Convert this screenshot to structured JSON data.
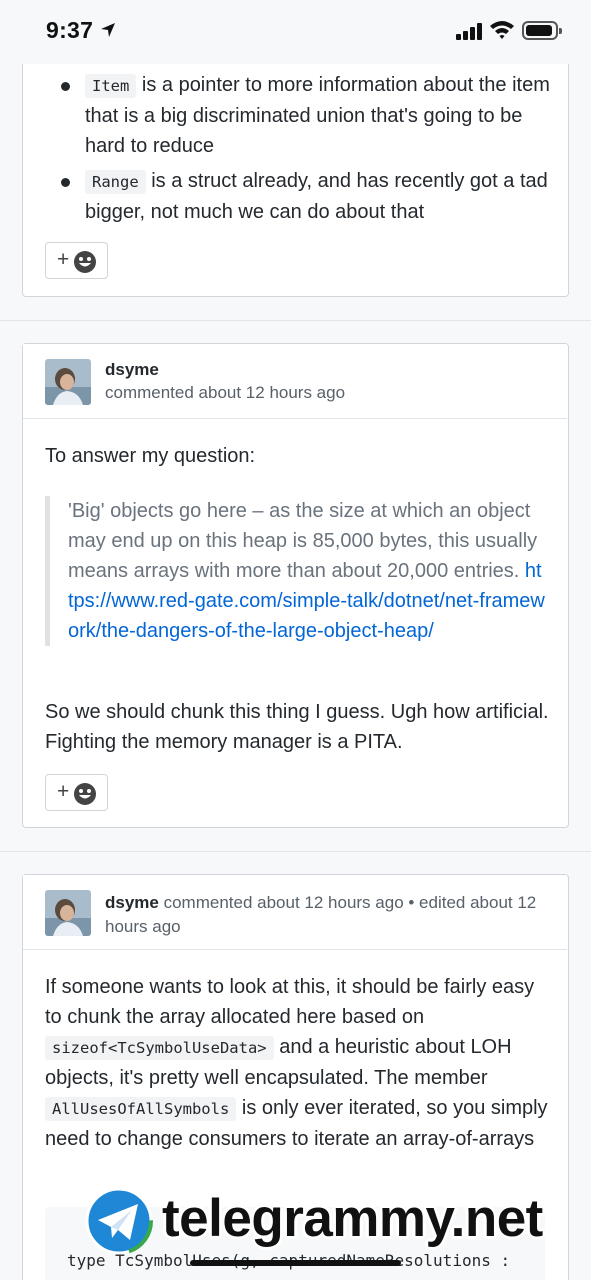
{
  "status_bar": {
    "time": "9:37"
  },
  "comment_prev": {
    "bullets": [
      {
        "code": "Item",
        "text": " is a pointer to more information about the item that is a big discriminated union that's going to be hard to reduce"
      },
      {
        "code": "Range",
        "text": " is a struct already, and has recently got a tad bigger, not much we can do about that"
      }
    ],
    "reaction_plus": "+"
  },
  "comment_2": {
    "author": "dsyme",
    "meta": "commented about 12 hours ago",
    "intro": "To answer my question:",
    "quote_text": "'Big' objects go here – as the size at which an object may end up on this heap is 85,000 bytes, this usually means arrays with more than about 20,000 entries. ",
    "quote_link": "https://www.red-gate.com/simple-talk/dotnet/net-framework/the-dangers-of-the-large-object-heap/",
    "closing": "So we should chunk this thing I guess. Ugh how artificial. Fighting the memory manager is a PITA.",
    "reaction_plus": "+"
  },
  "comment_3": {
    "author": "dsyme",
    "meta": " commented about 12 hours ago • edited about 12 hours ago",
    "p1_a": "If someone wants to look at this, it should be fairly easy to chunk the array allocated here based on ",
    "p1_code1": "sizeof<TcSymbolUseData>",
    "p1_b": " and a heuristic about LOH objects, it's pretty well encapsulated. The member ",
    "p1_code2": "AllUsesOfAllSymbols",
    "p1_c": " is only ever iterated, so you simply need to change consumers to iterate an array-of-arrays",
    "code_line": "type TcSymbolUses(g, capturedNameResolutions :"
  },
  "watermark": {
    "text": "telegrammy.net"
  },
  "colors": {
    "link": "#0366d6",
    "text": "#24292e",
    "muted": "#586069",
    "border": "#d1d5da"
  }
}
